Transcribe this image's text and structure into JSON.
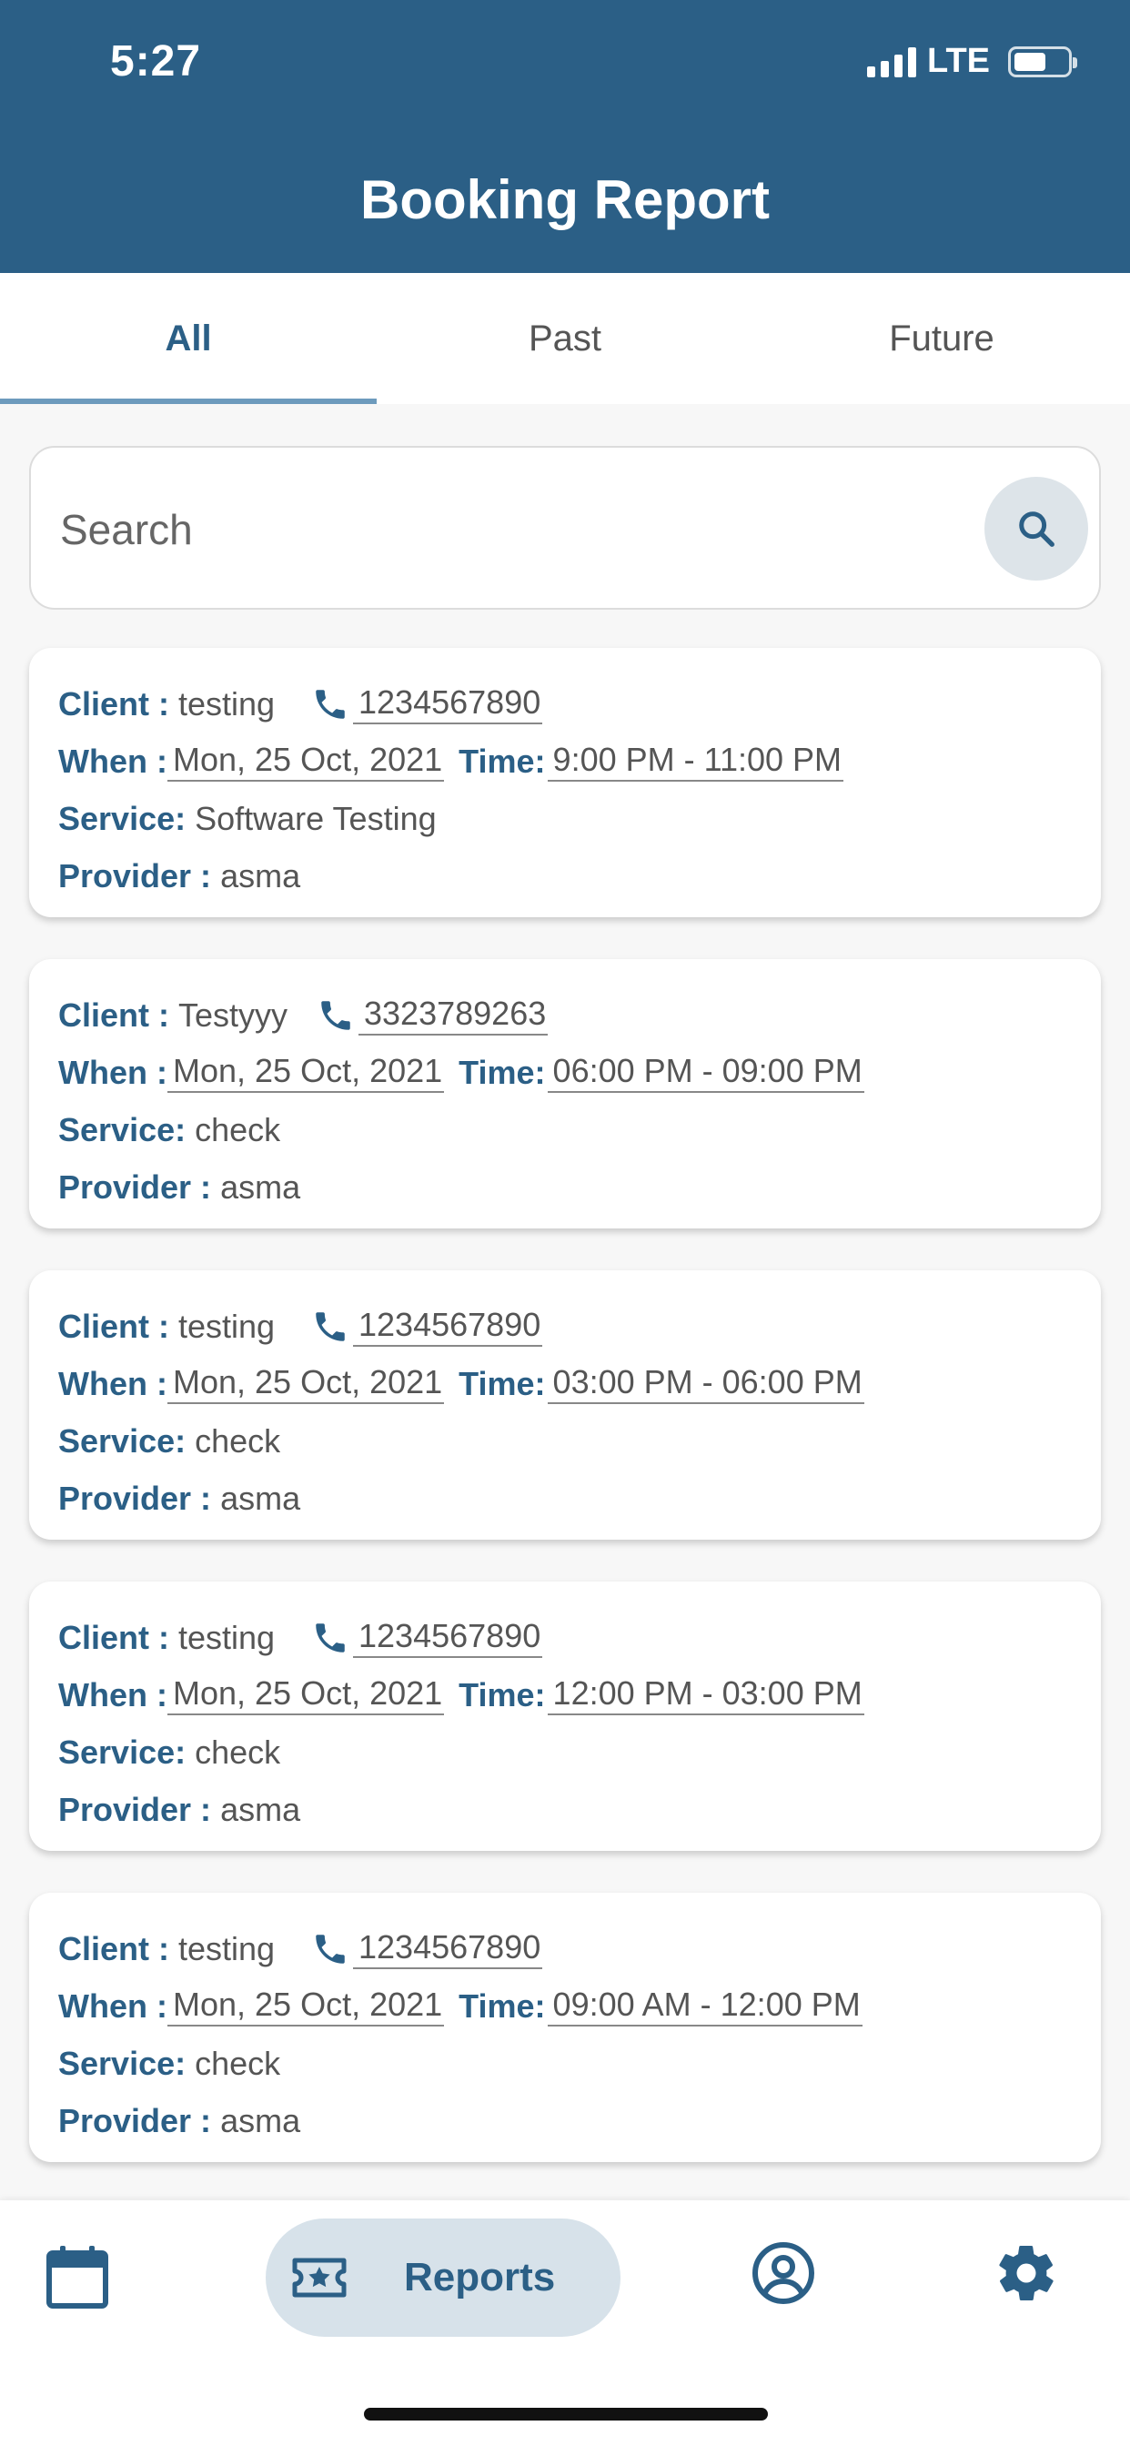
{
  "status_bar": {
    "time": "5:27",
    "network": "LTE",
    "battery_level": 0.5
  },
  "header": {
    "title": "Booking Report",
    "background": "#2b5f86"
  },
  "tabs": [
    {
      "label": "All",
      "active": true
    },
    {
      "label": "Past",
      "active": false
    },
    {
      "label": "Future",
      "active": false
    }
  ],
  "search": {
    "placeholder": "Search",
    "value": ""
  },
  "labels": {
    "client": "Client :",
    "when": "When :",
    "time": "Time:",
    "service": "Service:",
    "provider": "Provider :"
  },
  "bookings": [
    {
      "client": "testing",
      "phone": "1234567890",
      "date": "Mon, 25 Oct, 2021",
      "time": "9:00 PM - 11:00 PM ",
      "service": "Software Testing",
      "provider": "asma"
    },
    {
      "client": "Testyyy",
      "phone": "3323789263",
      "date": "Mon, 25 Oct, 2021",
      "time": "06:00 PM - 09:00 PM ",
      "service": "check",
      "provider": "asma"
    },
    {
      "client": "testing",
      "phone": "1234567890",
      "date": "Mon, 25 Oct, 2021",
      "time": "03:00 PM - 06:00 PM ",
      "service": "check",
      "provider": "asma"
    },
    {
      "client": "testing",
      "phone": "1234567890",
      "date": "Mon, 25 Oct, 2021",
      "time": "12:00 PM - 03:00 PM ",
      "service": "check",
      "provider": "asma"
    },
    {
      "client": "testing",
      "phone": "1234567890",
      "date": "Mon, 25 Oct, 2021",
      "time": "09:00 AM - 12:00 PM ",
      "service": "check",
      "provider": "asma"
    }
  ],
  "bottom_nav": {
    "items": [
      {
        "icon": "calendar-icon",
        "label": "",
        "active": false
      },
      {
        "icon": "ticket-star-icon",
        "label": "Reports",
        "active": true
      },
      {
        "icon": "profile-icon",
        "label": "",
        "active": false
      },
      {
        "icon": "gear-icon",
        "label": "",
        "active": false
      }
    ]
  },
  "colors": {
    "accent": "#2b5f86",
    "active_tab_indicator": "#6d9bbd",
    "active_nav_bg": "#d7e2ea"
  }
}
